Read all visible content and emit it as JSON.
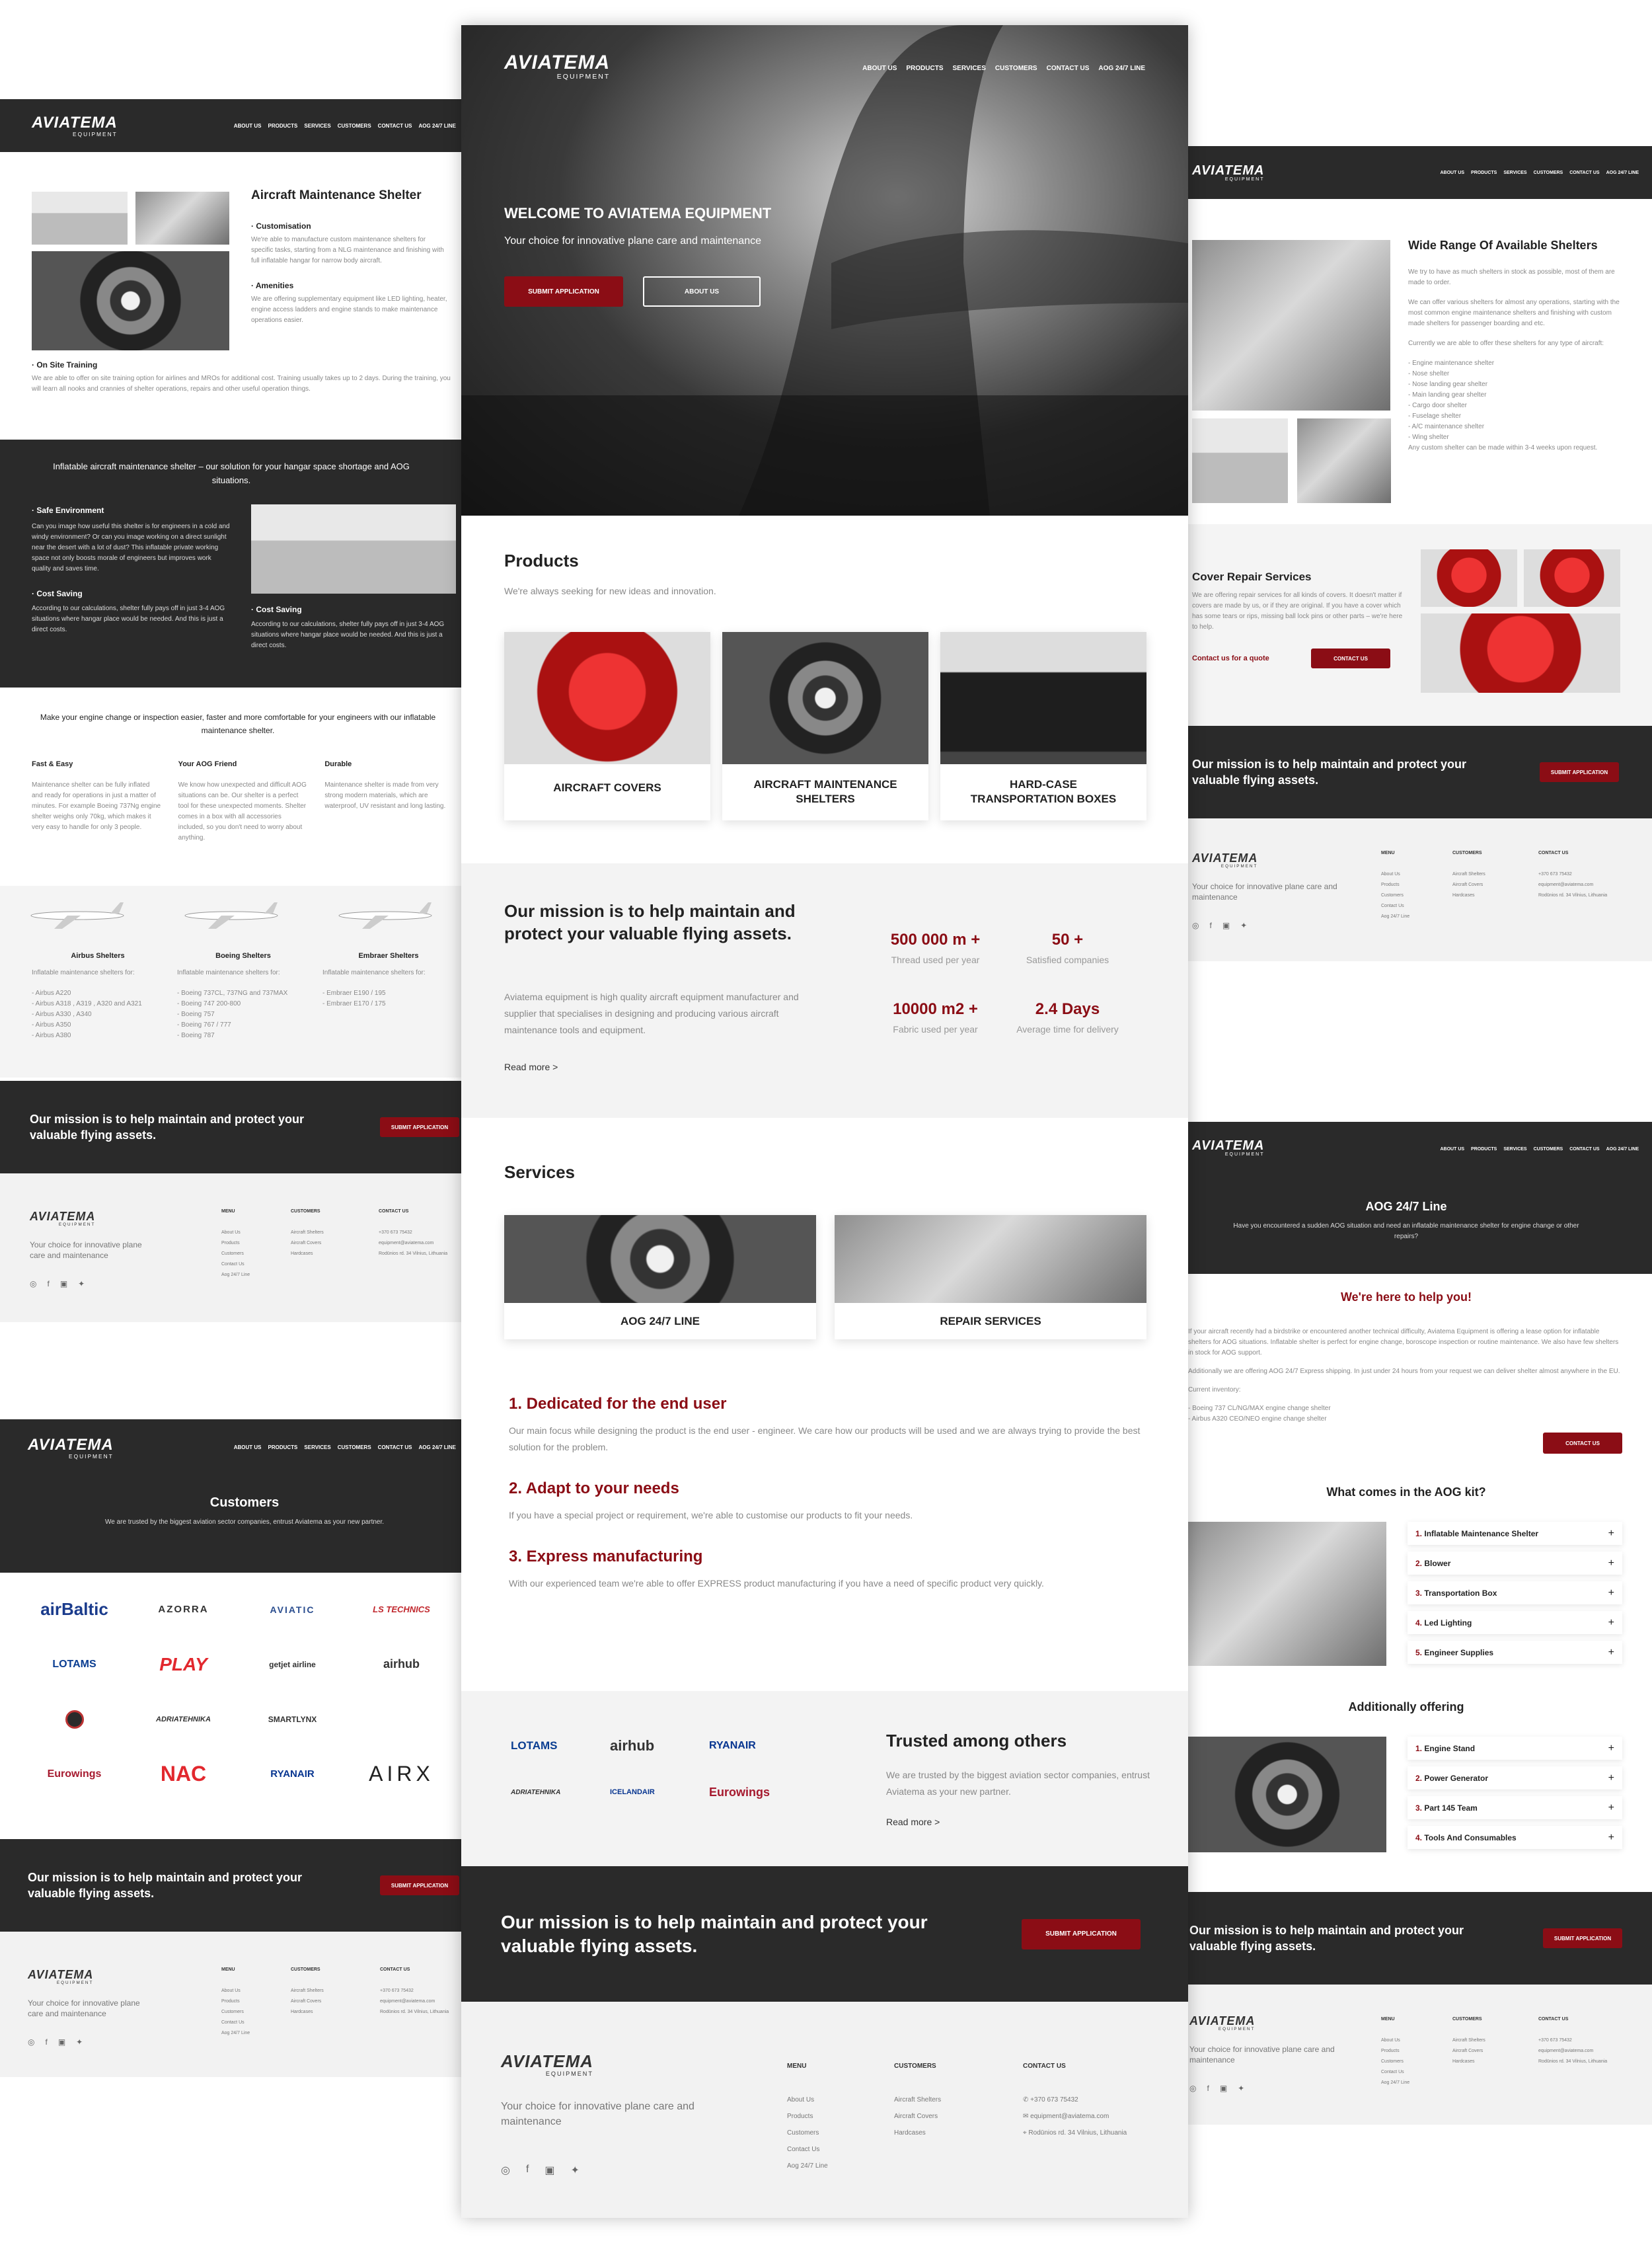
{
  "brand": {
    "name": "AVIATEMA",
    "sub": "EQUIPMENT",
    "tagline": "Your choice for innovative plane care and maintenance"
  },
  "nav": [
    "ABOUT US",
    "PRODUCTS",
    "SERVICES",
    "CUSTOMERS",
    "CONTACT US",
    "AOG 24/7 LINE"
  ],
  "mission": {
    "text": "Our mission is to help maintain and protect your valuable flying assets.",
    "button": "SUBMIT APPLICATION"
  },
  "footer": {
    "menu_title": "MENU",
    "menu": [
      "About Us",
      "Products",
      "Customers",
      "Contact Us",
      "Aog 24/7 Line"
    ],
    "customers_title": "CUSTOMERS",
    "customers": [
      "Aircraft Shelters",
      "Aircraft Covers",
      "Hardcases"
    ],
    "contact_title": "CONTACT US",
    "phone": "+370 673 75432",
    "email": "equipment@aviatema.com",
    "address": "Rodūnios rd. 34 Vilnius, Lithuania"
  },
  "center": {
    "hero": {
      "title": "WELCOME TO AVIATEMA EQUIPMENT",
      "subtitle": "Your choice for innovative plane care and maintenance",
      "btn1": "SUBMIT APPLICATION",
      "btn2": "ABOUT US"
    },
    "products": {
      "title": "Products",
      "subtitle": "We're always seeking for new ideas and innovation.",
      "items": [
        "AIRCRAFT COVERS",
        "AIRCRAFT MAINTENANCE SHELTERS",
        "HARD-CASE TRANSPORTATION BOXES"
      ]
    },
    "mission_block": {
      "title": "Our mission is to help maintain and protect your valuable flying assets.",
      "body": "Aviatema equipment is high quality aircraft equipment manufacturer and supplier that specialises in designing and producing various aircraft maintenance tools and equipment.",
      "read_more": "Read more >",
      "stats": [
        {
          "value": "500 000 m +",
          "label": "Thread used per year"
        },
        {
          "value": "50 +",
          "label": "Satisfied companies"
        },
        {
          "value": "10000 m2 +",
          "label": "Fabric used per year"
        },
        {
          "value": "2.4 Days",
          "label": "Average time for delivery"
        }
      ]
    },
    "services": {
      "title": "Services",
      "items": [
        "AOG 24/7 LINE",
        "REPAIR SERVICES"
      ]
    },
    "features": [
      {
        "title": "1. Dedicated for the end user",
        "body": "Our main focus while designing the product is the end user - engineer. We care how our products will be used and we are always trying to provide the best solution for the problem."
      },
      {
        "title": "2. Adapt to your needs",
        "body": "If you have a special project or requirement, we're able to customise our products to fit your needs."
      },
      {
        "title": "3. Express manufacturing",
        "body": "With our experienced team we're able to offer EXPRESS product manufacturing if you have a need of specific product very quickly."
      }
    ],
    "trusted": {
      "title": "Trusted among others",
      "body": "We are trusted by the biggest aviation sector companies, entrust Aviatema as your new partner.",
      "read_more": "Read more >",
      "logos": [
        "LOTAMS",
        "airhub",
        "RYANAIR",
        "ADRIATEHNIKA",
        "ICELANDAIR",
        "Eurowings"
      ]
    }
  },
  "left1": {
    "title": "Aircraft Maintenance Shelter",
    "custom_title": "· Customisation",
    "custom_body": "We're able to manufacture custom maintenance shelters for specific tasks, starting from a NLG maintenance and finishing with full inflatable hangar for narrow body aircraft.",
    "amen_title": "· Amenities",
    "amen_body": "We are offering supplementary equipment like LED lighting, heater, engine access ladders and engine stands to make maintenance operations easier.",
    "train_title": "· On Site Training",
    "train_body": "We are able to offer on site training option for airlines and MROs for additional cost. Training usually takes up to 2 days. During the training, you will learn all nooks and crannies of shelter operations, repairs and other useful operation things.",
    "dark_title": "Inflatable aircraft maintenance shelter – our solution for your hangar space shortage and AOG situations.",
    "safe_title": "· Safe Environment",
    "safe_body": "Can you image how useful this shelter is for engineers in a cold and windy environment? Or can you image working on a direct sunlight near the desert with a lot of dust? This inflatable private working space not only boosts morale of engineers but improves work quality and saves time.",
    "cost_title": "· Cost Saving",
    "cost_body": "According to our calculations, shelter fully pays off in just 3-4 AOG situations where hangar place would be needed. And this is just a direct costs.",
    "intro": "Make your engine change or inspection easier, faster and more comfortable for your engineers with our inflatable maintenance shelter.",
    "cols": [
      {
        "title": "Fast & Easy",
        "body": "Maintenance shelter can be fully inflated and ready for operations in just a matter of minutes. For example Boeing 737Ng engine shelter weighs only 70kg, which makes it very easy to handle for only 3 people."
      },
      {
        "title": "Your AOG Friend",
        "body": "We know how unexpected and difficult AOG situations can be. Our shelter is a perfect tool for these unexpected moments. Shelter comes in a box with all accessories included, so you don't need to worry about anything."
      },
      {
        "title": "Durable",
        "body": "Maintenance shelter is made from very strong modern materials, which are waterproof, UV resistant and long lasting."
      }
    ],
    "planes": [
      {
        "title": "Airbus Shelters",
        "sub": "Inflatable maintenance shelters for:",
        "list": [
          "- Airbus A220",
          "- Airbus A318 , A319 , A320 and A321",
          "- Airbus A330 , A340",
          "- Airbus A350",
          "- Airbus A380"
        ]
      },
      {
        "title": "Boeing Shelters",
        "sub": "Inflatable maintenance shelters for:",
        "list": [
          "- Boeing 737CL, 737NG and 737MAX",
          "- Boeing 747 200-800",
          "- Boeing 757",
          "- Boeing 767 / 777",
          "- Boeing 787"
        ]
      },
      {
        "title": "Embraer Shelters",
        "sub": "Inflatable maintenance shelters for:",
        "list": [
          "- Embraer E190 / 195",
          "- Embraer E170 / 175"
        ]
      }
    ]
  },
  "left2": {
    "title": "Customers",
    "subtitle": "We are trusted by the biggest aviation sector companies, entrust Aviatema as your new partner.",
    "logos": [
      "airBaltic",
      "AZORRA",
      "AVIATIC",
      "LS TECHNICS",
      "LOTAMS",
      "PLAY",
      "getjet airline",
      "airhub",
      "",
      "ADRIATEHNIKA",
      "SMARTLYNX",
      "",
      "Eurowings",
      "NAC",
      "RYANAIR",
      "AIRX"
    ]
  },
  "right1": {
    "title": "Wide Range Of Available Shelters",
    "p1": "We try to have as much shelters in stock as possible, most of them are made to order.",
    "p2": "We can offer various shelters for almost any operations, starting with the most common engine maintenance shelters and finishing with custom made shelters for passenger boarding and etc.",
    "p3": "Currently we are able to offer these shelters for any type of aircraft:",
    "list": [
      "- Engine maintenance shelter",
      "- Nose shelter",
      "- Nose landing gear shelter",
      "- Main landing gear shelter",
      "- Cargo door shelter",
      "- Fuselage shelter",
      "- A/C maintenance shelter",
      "- Wing shelter",
      "Any custom shelter can be made within 3-4 weeks upon request."
    ],
    "repair_title": "Cover Repair Services",
    "repair_body": "We are offering repair services for all kinds of covers. It doesn't matter if covers are made by us, or if they are original. If you have a cover which has some tears or rips, missing ball lock pins or other parts – we're here to help.",
    "repair_link": "Contact us for a quote",
    "repair_btn": "CONTACT US"
  },
  "right2": {
    "title": "AOG 24/7 Line",
    "subtitle": "Have you encountered a sudden AOG situation and need an inflatable maintenance shelter for engine change or other repairs?",
    "help_title": "We're here to help you!",
    "p1": "If your aircraft recently had a birdstrike or encountered another technical difficulty, Aviatema Equipment is offering a lease option for inflatable shelters for AOG situations. Inflatable shelter is perfect for engine change, boroscope inspection or routine maintenance. We also have few shelters in stock for AOG support.",
    "p2": "Additionally we are offering AOG 24/7 Express shipping. In just under 24 hours from your request we can deliver shelter almost anywhere in the EU.",
    "inv_title": "Current inventory:",
    "inv": [
      "- Boeing 737 CL/NG/MAX engine change shelter",
      "- Airbus A320 CEO/NEO engine change shelter"
    ],
    "contact_btn": "CONTACT US",
    "kit_title": "What comes in the AOG kit?",
    "kit": [
      {
        "n": "1.",
        "t": "Inflatable Maintenance Shelter"
      },
      {
        "n": "2.",
        "t": "Blower"
      },
      {
        "n": "3.",
        "t": "Transportation Box"
      },
      {
        "n": "4.",
        "t": "Led Lighting"
      },
      {
        "n": "5.",
        "t": "Engineer Supplies"
      }
    ],
    "add_title": "Additionally offering",
    "add": [
      {
        "n": "1.",
        "t": "Engine Stand"
      },
      {
        "n": "2.",
        "t": "Power Generator"
      },
      {
        "n": "3.",
        "t": "Part 145 Team"
      },
      {
        "n": "4.",
        "t": "Tools And Consumables"
      }
    ]
  }
}
